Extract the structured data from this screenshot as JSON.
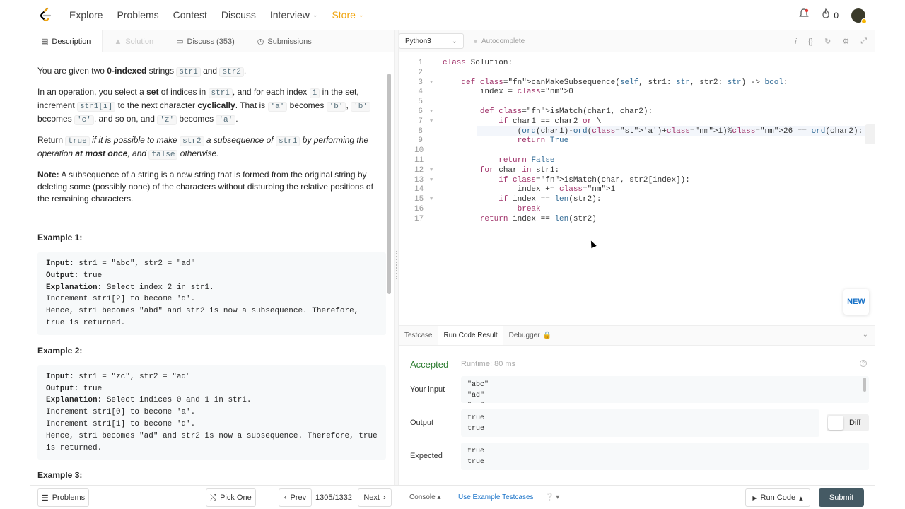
{
  "nav": {
    "items": [
      "Explore",
      "Problems",
      "Contest",
      "Discuss",
      "Interview",
      "Store"
    ],
    "fire_count": "0"
  },
  "left_tabs": [
    "Description",
    "Solution",
    "Discuss (353)",
    "Submissions"
  ],
  "problem": {
    "p1_a": "You are given two ",
    "p1_b": "0-indexed",
    "p1_c": " strings ",
    "p1_code1": "str1",
    "p1_d": " and ",
    "p1_code2": "str2",
    "p1_e": ".",
    "p2_a": "In an operation, you select a ",
    "p2_b": "set",
    "p2_c": " of indices in ",
    "p2_code1": "str1",
    "p2_d": ", and for each index ",
    "p2_code2": "i",
    "p2_e": " in the set, increment ",
    "p2_code3": "str1[i]",
    "p2_f": " to the next character ",
    "p2_g": "cyclically",
    "p2_h": ". That is ",
    "p2_code4": "'a'",
    "p2_i": " becomes ",
    "p2_code5": "'b'",
    "p2_j": ", ",
    "p2_code6": "'b'",
    "p2_k": " becomes ",
    "p2_code7": "'c'",
    "p2_l": ", and so on, and ",
    "p2_code8": "'z'",
    "p2_m": " becomes ",
    "p2_code9": "'a'",
    "p2_n": ".",
    "p3_a": "Return ",
    "p3_code1": "true",
    "p3_b": " if it is possible to make ",
    "p3_code2": "str2",
    "p3_c": " a subsequence of ",
    "p3_code3": "str1",
    "p3_d": " by performing the operation ",
    "p3_e": "at most once",
    "p3_f": ", and ",
    "p3_code4": "false",
    "p3_g": " otherwise.",
    "note_label": "Note:",
    "note_text": " A subsequence of a string is a new string that is formed from the original string by deleting some (possibly none) of the characters without disturbing the relative positions of the remaining characters.",
    "ex1_title": "Example 1:",
    "ex1_input_label": "Input:",
    "ex1_input": " str1 = \"abc\", str2 = \"ad\"",
    "ex1_output_label": "Output:",
    "ex1_output": " true",
    "ex1_expl_label": "Explanation:",
    "ex1_expl": " Select index 2 in str1.\nIncrement str1[2] to become 'd'. \nHence, str1 becomes \"abd\" and str2 is now a subsequence. Therefore, true is returned.",
    "ex2_title": "Example 2:",
    "ex2_input_label": "Input:",
    "ex2_input": " str1 = \"zc\", str2 = \"ad\"",
    "ex2_output_label": "Output:",
    "ex2_output": " true",
    "ex2_expl_label": "Explanation:",
    "ex2_expl": " Select indices 0 and 1 in str1. \nIncrement str1[0] to become 'a'. \nIncrement str1[1] to become 'd'. \nHence, str1 becomes \"ad\" and str2 is now a subsequence. Therefore, true is returned.",
    "ex3_title": "Example 3:"
  },
  "editor": {
    "language": "Python3",
    "autocomplete": "Autocomplete",
    "lines": [
      "class Solution:",
      "",
      "    def canMakeSubsequence(self, str1: str, str2: str) -> bool:",
      "        index = 0",
      "",
      "        def isMatch(char1, char2):",
      "            if char1 == char2 or \\",
      "                (ord(char1)-ord('a')+1)%26 == ord(char2):",
      "                return True",
      "",
      "            return False",
      "        for char in str1:",
      "            if isMatch(char, str2[index]):",
      "                index += 1",
      "            if index == len(str2):",
      "                break",
      "        return index == len(str2)"
    ],
    "new_label": "NEW"
  },
  "console": {
    "tabs": [
      "Testcase",
      "Run Code Result",
      "Debugger"
    ],
    "status": "Accepted",
    "runtime": "Runtime: 80 ms",
    "your_input_label": "Your input",
    "your_input": "\"abc\"\n\"ad\"\n\"zc\"",
    "output_label": "Output",
    "output": "true\ntrue",
    "expected_label": "Expected",
    "expected": "true\ntrue",
    "diff_label": "Diff"
  },
  "bottom": {
    "problems": "Problems",
    "pick_one": "Pick One",
    "prev": "Prev",
    "page": "1305/1332",
    "next": "Next",
    "console": "Console",
    "use_example": "Use Example Testcases",
    "run_code": "Run Code",
    "submit": "Submit"
  },
  "colors": {
    "accent": "#f0a30a",
    "accepted": "#2e7d32",
    "submit_bg": "#455a64",
    "link": "#1a73c8"
  }
}
